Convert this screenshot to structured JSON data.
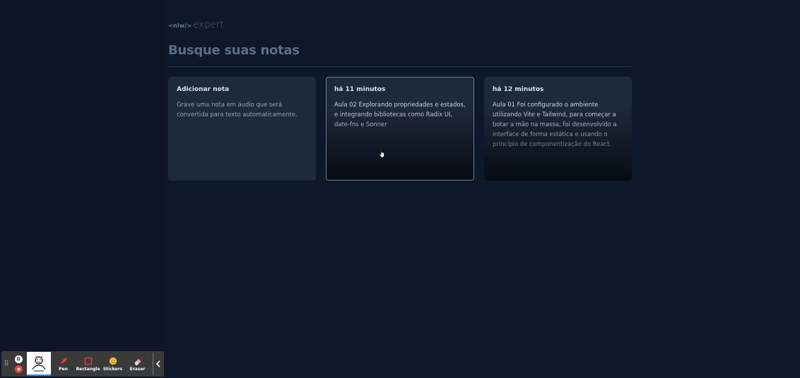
{
  "logo": {
    "mark": "<nlw/>",
    "word": "expert"
  },
  "search": {
    "placeholder": "Busque suas notas"
  },
  "cards": {
    "add": {
      "title": "Adicionar nota",
      "body": "Grave uma nota em áudio que será convertida para texto automaticamente."
    },
    "note1": {
      "title": "há 11 minutos",
      "body": "Aula 02 Explorando propriedades e estados, e integrando bibliotecas como Radix UI, date-fns e Sonner"
    },
    "note2": {
      "title": "há 12 minutos",
      "body": "Aula 01 Foi configurado o ambiente utilizando Vite e Tailwind, para começar a botar a mão na massa, foi desenvolvido a interface de forma estática e usando o princípio de componentização do React."
    }
  },
  "toolbar": {
    "pen": "Pen",
    "rectangle": "Rectangle",
    "stickers": "Stickers",
    "eraser": "Eraser"
  },
  "colors": {
    "background": "#0f172a",
    "card": "#1e293b",
    "accent_red": "#e6463c"
  }
}
